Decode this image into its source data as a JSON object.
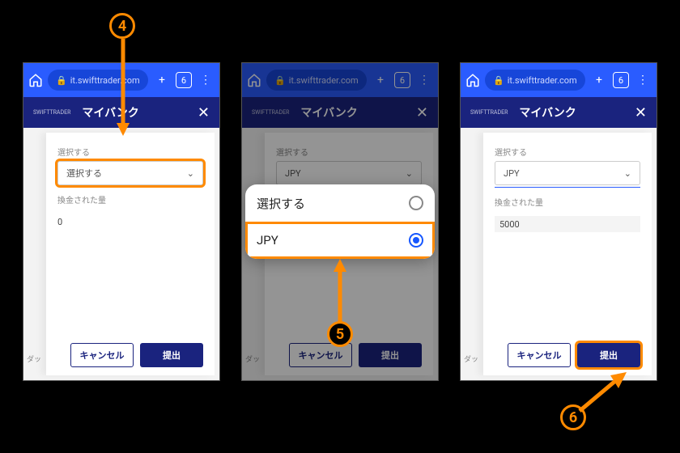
{
  "browser": {
    "url": "it.swifttrader.com",
    "tab_count": "6"
  },
  "app": {
    "brand": "SWIFTTRADER",
    "title": "マイバンク"
  },
  "fields": {
    "select_label": "選択する",
    "converted_label": "換金された量"
  },
  "buttons": {
    "cancel": "キャンセル",
    "submit": "提出"
  },
  "sidebar_caption": "ダッ",
  "screens": [
    {
      "select_value": "選択する",
      "amount_value": "0"
    },
    {
      "select_value": "JPY",
      "amount_value": "",
      "sheet": {
        "opt_placeholder": "選択する",
        "opt_selected": "JPY"
      }
    },
    {
      "select_value": "JPY",
      "amount_value": "5000"
    }
  ],
  "annotations": {
    "step4": "4",
    "step5": "5",
    "step6": "6"
  }
}
